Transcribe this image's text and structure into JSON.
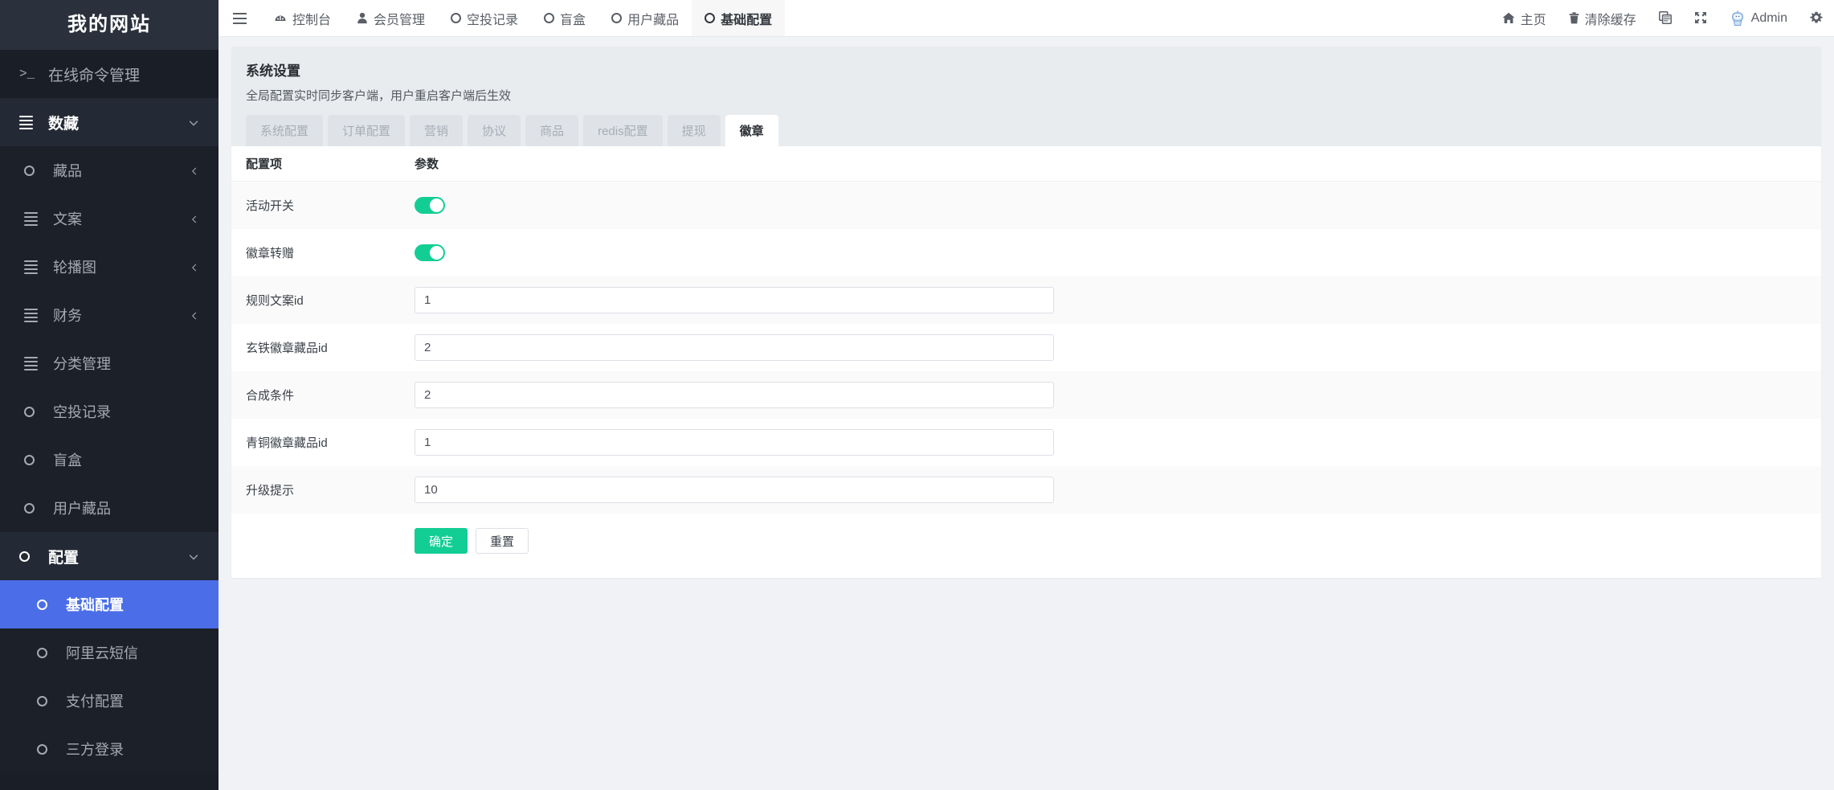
{
  "brand": {
    "title": "我的网站"
  },
  "sidebar": {
    "items": [
      {
        "label": "在线命令管理",
        "icon": "terminal-icon",
        "level": 0,
        "arrow": "",
        "state": "normal"
      },
      {
        "label": "数藏",
        "icon": "list-icon",
        "level": 0,
        "arrow": "chevron-down-icon",
        "state": "open"
      },
      {
        "label": "藏品",
        "icon": "circle-icon",
        "level": 1,
        "arrow": "chevron-left-icon",
        "state": "normal"
      },
      {
        "label": "文案",
        "icon": "list-icon",
        "level": 1,
        "arrow": "chevron-left-icon",
        "state": "normal"
      },
      {
        "label": "轮播图",
        "icon": "list-icon",
        "level": 1,
        "arrow": "chevron-left-icon",
        "state": "normal"
      },
      {
        "label": "财务",
        "icon": "list-icon",
        "level": 1,
        "arrow": "chevron-left-icon",
        "state": "normal"
      },
      {
        "label": "分类管理",
        "icon": "list-icon",
        "level": 1,
        "arrow": "",
        "state": "normal"
      },
      {
        "label": "空投记录",
        "icon": "circle-icon",
        "level": 1,
        "arrow": "",
        "state": "normal"
      },
      {
        "label": "盲盒",
        "icon": "circle-icon",
        "level": 1,
        "arrow": "",
        "state": "normal"
      },
      {
        "label": "用户藏品",
        "icon": "circle-icon",
        "level": 1,
        "arrow": "",
        "state": "normal"
      },
      {
        "label": "配置",
        "icon": "circle-icon",
        "level": 0,
        "arrow": "chevron-down-icon",
        "state": "open"
      },
      {
        "label": "基础配置",
        "icon": "circle-icon",
        "level": 2,
        "arrow": "",
        "state": "active"
      },
      {
        "label": "阿里云短信",
        "icon": "circle-icon",
        "level": 2,
        "arrow": "",
        "state": "normal"
      },
      {
        "label": "支付配置",
        "icon": "circle-icon",
        "level": 2,
        "arrow": "",
        "state": "normal"
      },
      {
        "label": "三方登录",
        "icon": "circle-icon",
        "level": 2,
        "arrow": "",
        "state": "normal"
      }
    ]
  },
  "topbar": {
    "menu_icon": "hamburger-icon",
    "tabs": [
      {
        "label": "控制台",
        "icon": "dashboard-icon",
        "active": false
      },
      {
        "label": "会员管理",
        "icon": "user-icon",
        "active": false
      },
      {
        "label": "空投记录",
        "icon": "circle-icon",
        "active": false
      },
      {
        "label": "盲盒",
        "icon": "circle-icon",
        "active": false
      },
      {
        "label": "用户藏品",
        "icon": "circle-icon",
        "active": false
      },
      {
        "label": "基础配置",
        "icon": "circle-icon",
        "active": true
      }
    ],
    "right": [
      {
        "label": "主页",
        "icon": "home-icon"
      },
      {
        "label": "清除缓存",
        "icon": "trash-icon"
      },
      {
        "label": "",
        "icon": "copy-icon"
      },
      {
        "label": "",
        "icon": "fullscreen-icon"
      },
      {
        "label": "Admin",
        "icon": "avatar-icon"
      },
      {
        "label": "",
        "icon": "gear-icon"
      }
    ]
  },
  "page": {
    "title": "系统设置",
    "subtitle": "全局配置实时同步客户端，用户重启客户端后生效",
    "tabs": [
      {
        "label": "系统配置",
        "active": false
      },
      {
        "label": "订单配置",
        "active": false
      },
      {
        "label": "营销",
        "active": false
      },
      {
        "label": "协议",
        "active": false
      },
      {
        "label": "商品",
        "active": false
      },
      {
        "label": "redis配置",
        "active": false
      },
      {
        "label": "提现",
        "active": false
      },
      {
        "label": "徽章",
        "active": true
      }
    ],
    "table": {
      "headers": {
        "col1": "配置项",
        "col2": "参数"
      },
      "rows": [
        {
          "label": "活动开关",
          "type": "toggle",
          "value": "on"
        },
        {
          "label": "徽章转赠",
          "type": "toggle",
          "value": "on"
        },
        {
          "label": "规则文案id",
          "type": "input",
          "value": "1"
        },
        {
          "label": "玄铁徽章藏品id",
          "type": "input",
          "value": "2"
        },
        {
          "label": "合成条件",
          "type": "input",
          "value": "2"
        },
        {
          "label": "青铜徽章藏品id",
          "type": "input",
          "value": "1"
        },
        {
          "label": "升级提示",
          "type": "input",
          "value": "10"
        }
      ]
    },
    "buttons": {
      "submit": "确定",
      "reset": "重置"
    }
  },
  "colors": {
    "sidebar_bg": "#191e27",
    "sidebar_active": "#4b6ee8",
    "primary_green": "#13ce94",
    "tab_inactive_bg": "#dfe3e8",
    "page_bg": "#f0f2f5"
  }
}
